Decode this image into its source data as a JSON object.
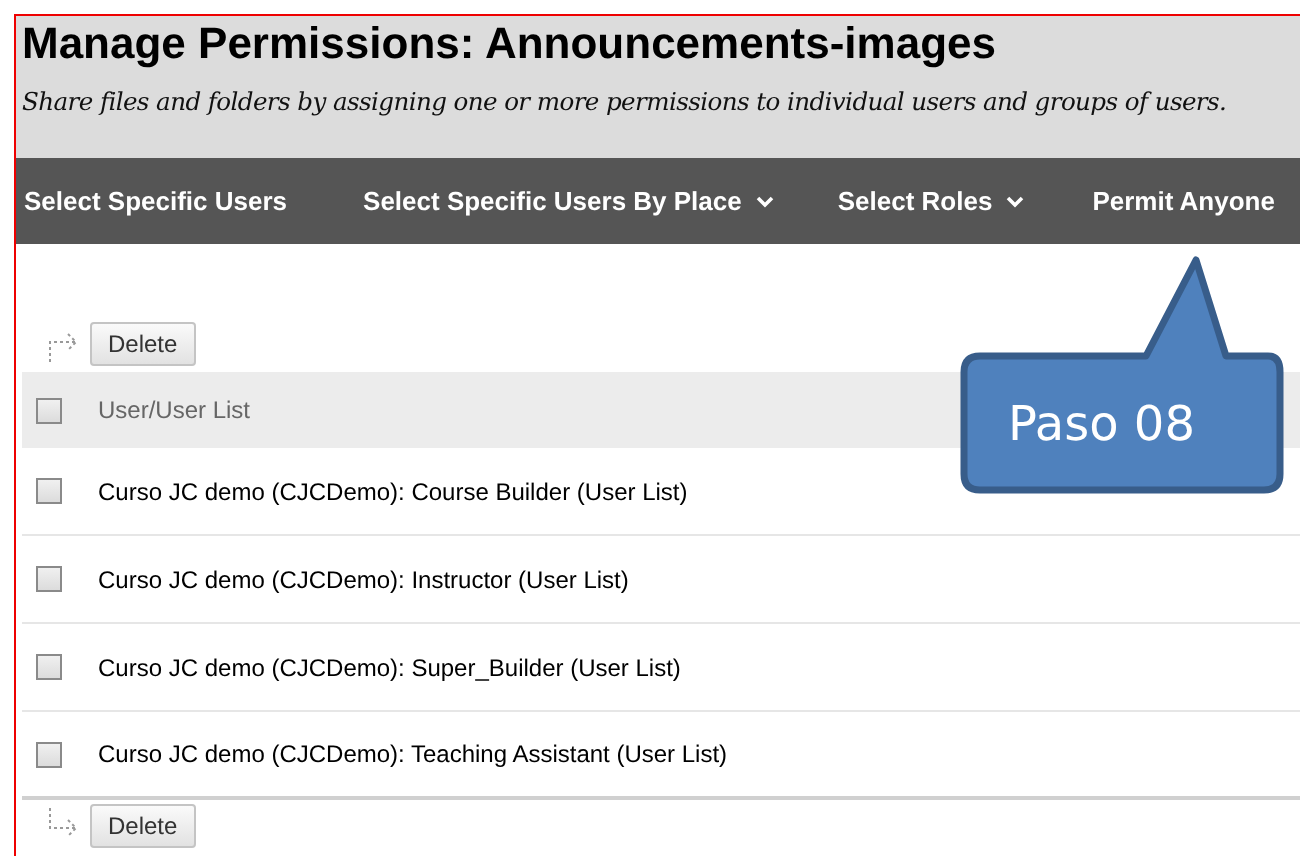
{
  "header": {
    "title": "Manage Permissions: Announcements-images",
    "subtitle": "Share files and folders by assigning one or more permissions to individual users and groups of users."
  },
  "nav": [
    {
      "label": "Select Specific Users",
      "has_menu": false
    },
    {
      "label": "Select Specific Users By Place",
      "has_menu": true
    },
    {
      "label": "Select Roles",
      "has_menu": true
    },
    {
      "label": "Permit Anyone",
      "has_menu": false
    }
  ],
  "top_action": "Delete",
  "table": {
    "column": "User/User List",
    "header_checked": false,
    "rows": [
      {
        "name": "Curso JC demo (CJCDemo): Course Builder (User List)",
        "checked": false
      },
      {
        "name": "Curso JC demo (CJCDemo): Instructor (User List)",
        "checked": false
      },
      {
        "name": "Curso JC demo (CJCDemo): Super_Builder (User List)",
        "checked": false
      },
      {
        "name": "Curso JC demo (CJCDemo): Teaching Assistant (User List)",
        "checked": false
      }
    ]
  },
  "bottom_action": "Delete",
  "callout": {
    "text": "Paso 08"
  }
}
